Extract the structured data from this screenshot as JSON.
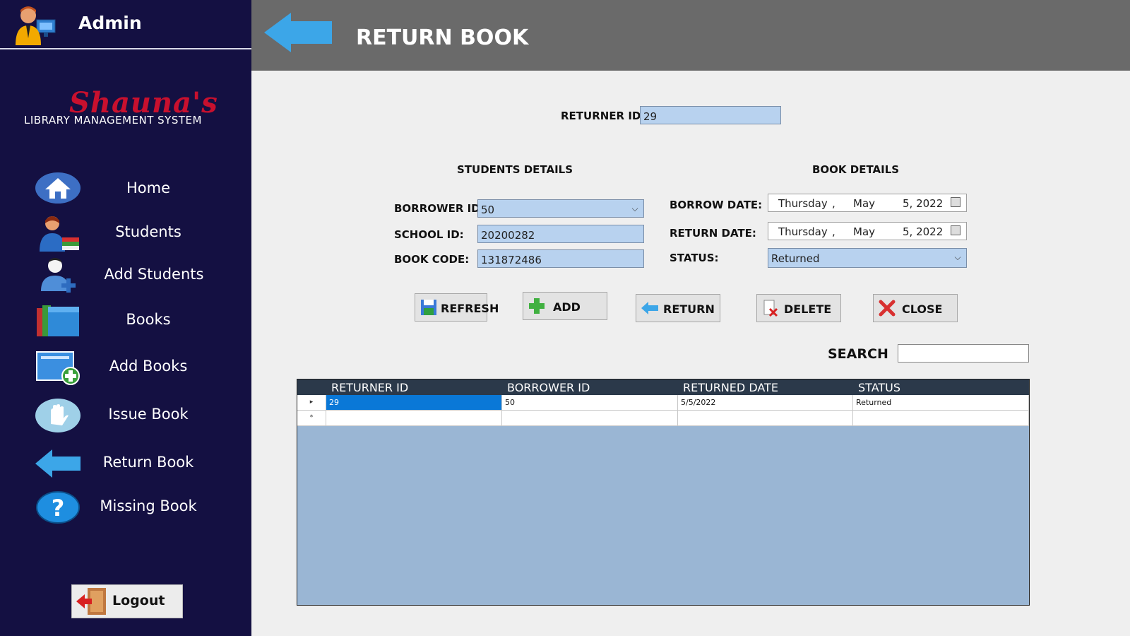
{
  "sidebar": {
    "admin_title": "Admin",
    "logo": {
      "script": "Shauna's",
      "subtitle": "LIBRARY MANAGEMENT SYSTEM"
    },
    "items": [
      {
        "label": "Home",
        "icon": "home-icon"
      },
      {
        "label": "Students",
        "icon": "students-icon"
      },
      {
        "label": "Add Students",
        "icon": "add-student-icon"
      },
      {
        "label": "Books",
        "icon": "books-icon"
      },
      {
        "label": "Add Books",
        "icon": "add-books-icon"
      },
      {
        "label": "Issue Book",
        "icon": "hand-icon"
      },
      {
        "label": "Return Book",
        "icon": "back-arrow-icon"
      },
      {
        "label": "Missing Book",
        "icon": "question-icon"
      }
    ],
    "logout_label": "Logout"
  },
  "header": {
    "title": "RETURN BOOK"
  },
  "form": {
    "returner_id_label": "RETURNER ID",
    "returner_id_value": "29",
    "students_section": "STUDENTS DETAILS",
    "book_section": "BOOK DETAILS",
    "borrower_id_label": "BORROWER ID:",
    "borrower_id_value": "50",
    "school_id_label": "SCHOOL ID:",
    "school_id_value": "20200282",
    "book_code_label": "BOOK CODE:",
    "book_code_value": "131872486",
    "borrow_date_label": "BORROW DATE:",
    "borrow_date": {
      "day": "Thursday",
      "sep": ",",
      "month": "May",
      "date": "5, 2022"
    },
    "return_date_label": "RETURN DATE:",
    "return_date": {
      "day": "Thursday",
      "sep": ",",
      "month": "May",
      "date": "5, 2022"
    },
    "status_label": "STATUS:",
    "status_value": "Returned"
  },
  "buttons": {
    "refresh": "REFRESH",
    "add": "ADD",
    "return": "RETURN",
    "delete": "DELETE",
    "close": "CLOSE"
  },
  "search": {
    "label": "SEARCH",
    "value": ""
  },
  "grid": {
    "columns": [
      "RETURNER ID",
      "BORROWER ID",
      "RETURNED DATE",
      "STATUS"
    ],
    "rows": [
      [
        "29",
        "50",
        "5/5/2022",
        "Returned"
      ]
    ],
    "row_marker": "▸",
    "new_row_marker": "*"
  },
  "colors": {
    "sidebar_bg": "#141042",
    "header_bg": "#6a6a6a",
    "field_bg": "#b8d2ef",
    "grid_bg": "#9ab6d4",
    "selection": "#0a78d7"
  }
}
